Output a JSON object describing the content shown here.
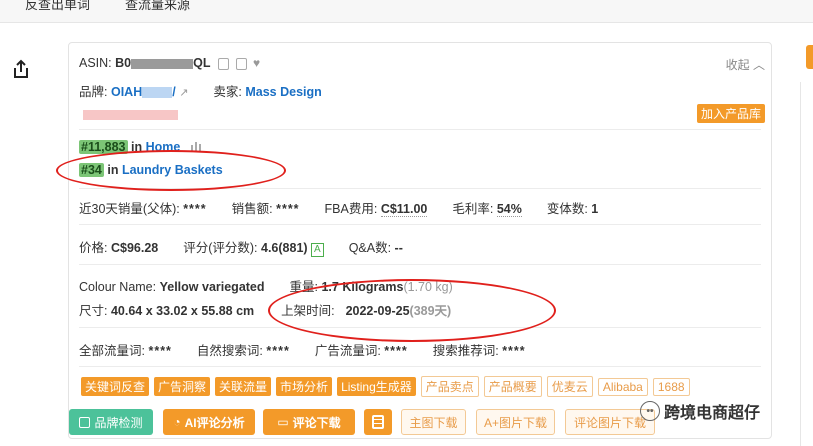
{
  "top_tabs": [
    "反查出单词",
    "查流量来源"
  ],
  "header": {
    "asin_label": "ASIN:",
    "asin_visible": "B0",
    "asin_suffix": "QL",
    "collapse_label": "收起"
  },
  "brand": {
    "label": "品牌:",
    "value_prefix": "OIAH",
    "seller_label": "卖家:",
    "seller_value": "Mass Design"
  },
  "add_to_library": "加入产品库",
  "rank_main": {
    "rank": "#11,883",
    "in": "in",
    "category": "Home"
  },
  "rank_sub": {
    "rank": "#34",
    "in": "in",
    "category": "Laundry Baskets"
  },
  "stats1": {
    "sales30_label": "近30天销量(父体):",
    "sales30_value": "****",
    "revenue_label": "销售额:",
    "revenue_value": "****",
    "fba_label": "FBA费用:",
    "fba_value": "C$11.00",
    "margin_label": "毛利率:",
    "margin_value": "54%",
    "variants_label": "变体数:",
    "variants_value": "1"
  },
  "stats2": {
    "price_label": "价格:",
    "price_value": "C$96.28",
    "rating_label": "评分(评分数):",
    "rating_value": "4.6(881)",
    "rating_badge": "A",
    "qa_label": "Q&A数:",
    "qa_value": "--"
  },
  "specs": {
    "colour_label": "Colour Name:",
    "colour_value": "Yellow variegated",
    "weight_label": "重量:",
    "weight_value": "1.7 Kilograms",
    "weight_alt": "(1.70 kg)",
    "size_label": "尺寸:",
    "size_value": "40.64 x 33.02 x 55.88 cm",
    "listed_label": "上架时间:",
    "listed_value": "2022-09-25",
    "listed_days": "(389天)"
  },
  "traffic": {
    "all_label": "全部流量词:",
    "all_value": "****",
    "organic_label": "自然搜索词:",
    "organic_value": "****",
    "ads_label": "广告流量词:",
    "ads_value": "****",
    "recommend_label": "搜索推荐词:",
    "recommend_value": "****"
  },
  "tags_solid": [
    "关键词反查",
    "广告洞察",
    "关联流量",
    "市场分析",
    "Listing生成器"
  ],
  "tags_outline": [
    "产品卖点",
    "产品概要",
    "优麦云",
    "Alibaba",
    "1688"
  ],
  "buttons": {
    "brand_check": "品牌检测",
    "ai_review": "AI评论分析",
    "review_download": "评论下载",
    "main_image_download": "主图下载",
    "aplus_download": "A+图片下载",
    "review_image_download": "评论图片下载"
  },
  "watermark": "跨境电商超仔",
  "colors": {
    "accent": "#f39a29",
    "link": "#1a6fc4",
    "green": "#4cc29a",
    "annotation": "#e0201c"
  }
}
